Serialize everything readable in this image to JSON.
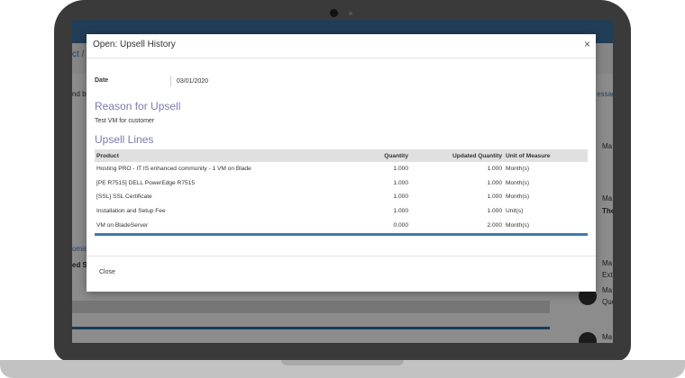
{
  "background": {
    "breadcrumb": "ct /",
    "field_label": "nd by",
    "panel_link": "essag",
    "right_labels": [
      "Ma",
      "Ma",
      "The",
      "Ma",
      "Ext",
      "Ma",
      "Quo",
      "Ma"
    ],
    "left_link": "omis",
    "left_text": "ed S"
  },
  "modal": {
    "title": "Open: Upsell History",
    "close_glyph": "×",
    "date_label": "Date",
    "date_value": "03/01/2020",
    "reason_title": "Reason for Upsell",
    "reason_text": "Test VM for customer",
    "lines_title": "Upsell Lines",
    "table": {
      "headers": [
        "Product",
        "Quantity",
        "Updated Quantity",
        "Unit of Measure"
      ],
      "rows": [
        [
          "Hosting PRO - IT IS enhanced community - 1 VM on Blade",
          "1.000",
          "1.000",
          "Month(s)"
        ],
        [
          "[PE R7515] DELL PowerEdge R7515",
          "1.000",
          "1.000",
          "Month(s)"
        ],
        [
          "[SSL] SSL Certificate",
          "1.000",
          "1.000",
          "Month(s)"
        ],
        [
          "Installation and Setup Fee",
          "1.000",
          "1.000",
          "Unit(s)"
        ],
        [
          "VM on BladeServer",
          "0.000",
          "2.000",
          "Month(s)"
        ]
      ]
    },
    "close_label": "Close"
  }
}
